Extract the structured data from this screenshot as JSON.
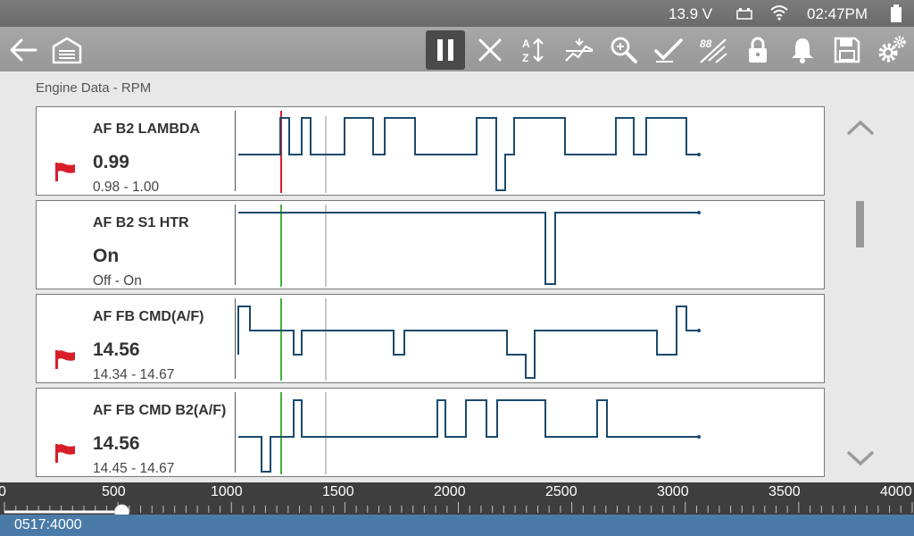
{
  "status": {
    "voltage": "13.9 V",
    "time": "02:47PM"
  },
  "toolbar": {
    "left": [
      "back-arrow-icon",
      "garage-icon"
    ],
    "right": [
      "pause-icon",
      "clear-icon",
      "sort-icon",
      "graph-overlay-icon",
      "zoom-icon",
      "checkmark-icon",
      "custom-list-icon",
      "lock-icon",
      "bell-icon",
      "save-icon",
      "settings-icon"
    ]
  },
  "page": {
    "title": "Engine Data -  RPM"
  },
  "colors": {
    "trace": "#1b4a6e",
    "cursor_red": "#d81e2a",
    "cursor_green": "#3fb23f",
    "flag": "#d81e2a",
    "accent_bar": "#4a7ba8"
  },
  "pids": [
    {
      "name": "AF B2 LAMBDA",
      "value": "0.99",
      "range": "0.98 - 1.00",
      "flagged": true,
      "cursor": "red"
    },
    {
      "name": "AF B2 S1 HTR",
      "value": "On",
      "range": "Off - On",
      "flagged": false,
      "cursor": "green"
    },
    {
      "name": "AF FB CMD(A/F)",
      "value": "14.56",
      "range": "14.34 - 14.67",
      "flagged": true,
      "cursor": "green"
    },
    {
      "name": "AF FB CMD B2(A/F)",
      "value": "14.56",
      "range": "14.45 - 14.67",
      "flagged": true,
      "cursor": "green"
    }
  ],
  "timeline": {
    "ticks": [
      "0",
      "500",
      "1000",
      "1500",
      "2000",
      "2500",
      "3000",
      "3500",
      "4000"
    ],
    "position": 517,
    "total": 4000,
    "counter": "0517:4000"
  }
}
